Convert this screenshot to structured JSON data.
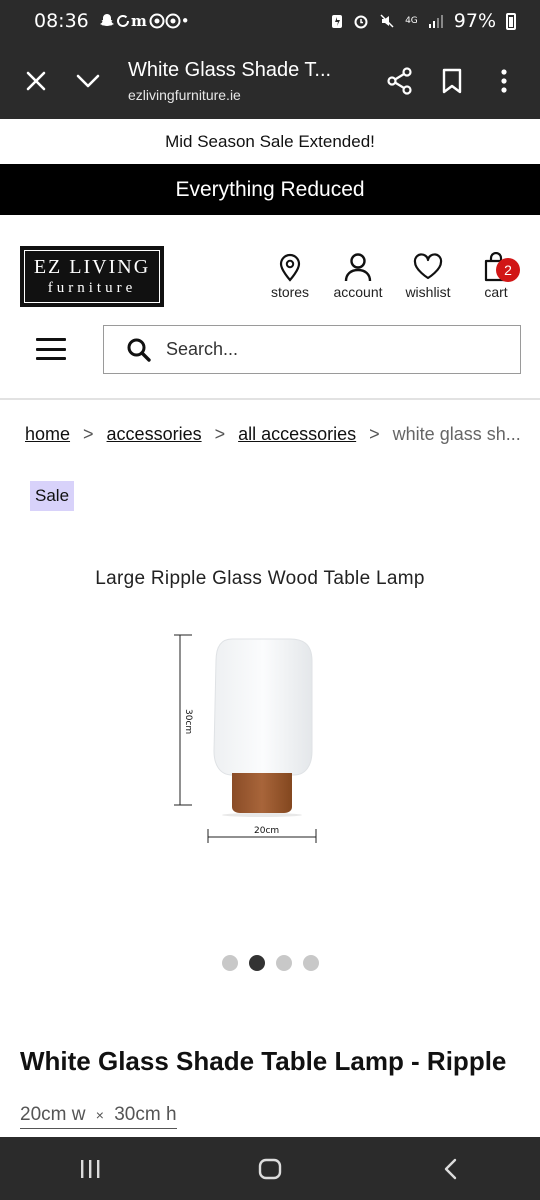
{
  "status_bar": {
    "time": "08:36",
    "left_icons": "•",
    "network": "4G",
    "battery": "97%"
  },
  "browser": {
    "page_title": "White Glass Shade T...",
    "url": "ezlivingfurniture.ie"
  },
  "promo": {
    "top_text": "Mid Season Sale Extended!",
    "black_text": "Everything Reduced"
  },
  "logo": {
    "line1": "EZ LIVING",
    "line2": "furniture"
  },
  "nav": {
    "stores": "stores",
    "account": "account",
    "wishlist": "wishlist",
    "cart": "cart",
    "cart_count": "2"
  },
  "search": {
    "placeholder": "Search..."
  },
  "breadcrumb": {
    "home": "home",
    "sep": ">",
    "accessories": "accessories",
    "all_accessories": "all accessories",
    "current": "white glass sh..."
  },
  "product": {
    "sale_badge": "Sale",
    "image_caption": "Large Ripple Glass Wood Table Lamp",
    "dim_height_label": "30cm",
    "dim_width_label": "20cm",
    "gallery_total": 4,
    "gallery_active": 2,
    "title": "White Glass Shade Table Lamp - Ripple",
    "dims_width": "20cm w",
    "dims_x": "×",
    "dims_height": "30cm h"
  },
  "colors": {
    "toolbar_bg": "#2b2b2b",
    "sale_badge_bg": "#d8d2fa",
    "cart_badge": "#d11616",
    "lamp_base": "#9a5a31"
  }
}
